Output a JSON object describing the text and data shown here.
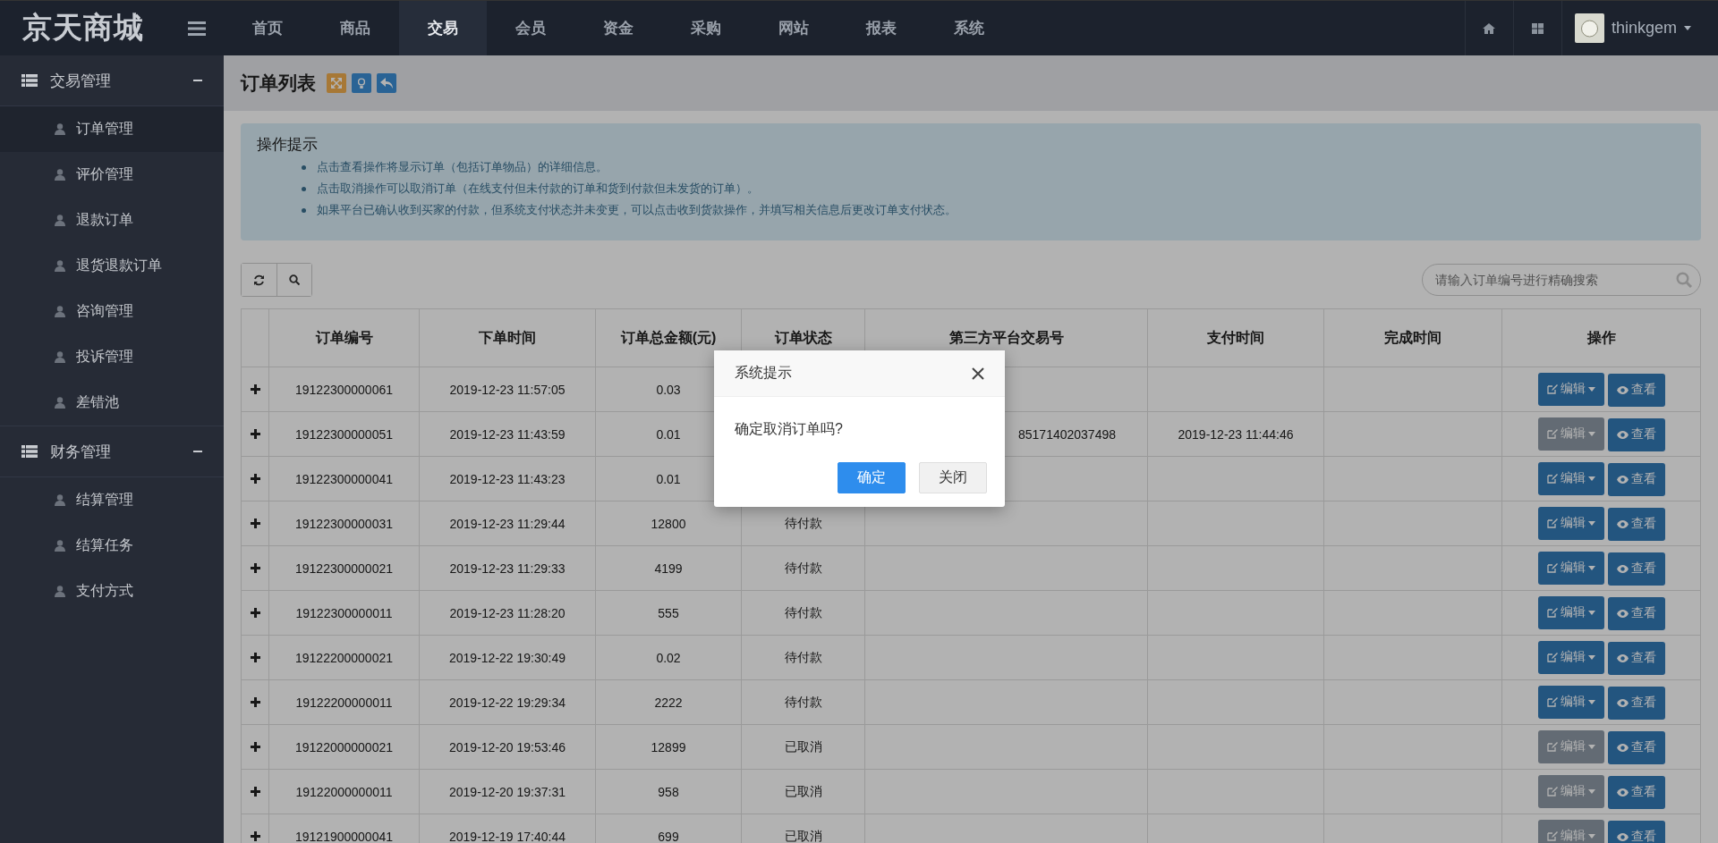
{
  "brand": "京天商城",
  "nav": [
    {
      "label": "首页",
      "selected": false
    },
    {
      "label": "商品",
      "selected": false
    },
    {
      "label": "交易",
      "selected": true
    },
    {
      "label": "会员",
      "selected": false
    },
    {
      "label": "资金",
      "selected": false
    },
    {
      "label": "采购",
      "selected": false
    },
    {
      "label": "网站",
      "selected": false
    },
    {
      "label": "报表",
      "selected": false
    },
    {
      "label": "系统",
      "selected": false
    }
  ],
  "user": {
    "name": "thinkgem"
  },
  "sidebar": [
    {
      "label": "交易管理",
      "expanded": true,
      "children": [
        {
          "label": "订单管理",
          "selected": true
        },
        {
          "label": "评价管理",
          "selected": false
        },
        {
          "label": "退款订单",
          "selected": false
        },
        {
          "label": "退货退款订单",
          "selected": false
        },
        {
          "label": "咨询管理",
          "selected": false
        },
        {
          "label": "投诉管理",
          "selected": false
        },
        {
          "label": "差错池",
          "selected": false
        }
      ]
    },
    {
      "label": "财务管理",
      "expanded": true,
      "children": [
        {
          "label": "结算管理",
          "selected": false
        },
        {
          "label": "结算任务",
          "selected": false
        },
        {
          "label": "支付方式",
          "selected": false
        }
      ]
    }
  ],
  "page": {
    "title": "订单列表"
  },
  "notice": {
    "title": "操作提示",
    "items": [
      "点击查看操作将显示订单（包括订单物品）的详细信息。",
      "点击取消操作可以取消订单（在线支付但未付款的订单和货到付款但未发货的订单）。",
      "如果平台已确认收到买家的付款，但系统支付状态并未变更，可以点击收到货款操作，并填写相关信息后更改订单支付状态。"
    ]
  },
  "search": {
    "placeholder": "请输入订单编号进行精确搜索"
  },
  "table": {
    "columns": [
      "订单编号",
      "下单时间",
      "订单总金额(元)",
      "订单状态",
      "第三方平台交易号",
      "支付时间",
      "完成时间",
      "操作"
    ],
    "rows": [
      {
        "order_no": "19122300000061",
        "time": "2019-12-23 11:57:05",
        "amount": "0.03",
        "edit": {
          "label": "编辑",
          "disabled": false
        },
        "view": "查看"
      },
      {
        "order_no": "19122300000051",
        "time": "2019-12-23 11:43:59",
        "amount": "0.01",
        "third_party": "85171402037498",
        "paid_time": "2019-12-23 11:44:46",
        "edit": {
          "label": "编辑",
          "disabled": true
        },
        "view": "查看"
      },
      {
        "order_no": "19122300000041",
        "time": "2019-12-23 11:43:23",
        "amount": "0.01",
        "edit": {
          "label": "编辑",
          "disabled": false
        },
        "view": "查看"
      },
      {
        "order_no": "19122300000031",
        "time": "2019-12-23 11:29:44",
        "amount": "12800",
        "status": "待付款",
        "edit": {
          "label": "编辑",
          "disabled": false
        },
        "view": "查看"
      },
      {
        "order_no": "19122300000021",
        "time": "2019-12-23 11:29:33",
        "amount": "4199",
        "status": "待付款",
        "edit": {
          "label": "编辑",
          "disabled": false
        },
        "view": "查看"
      },
      {
        "order_no": "19122300000011",
        "time": "2019-12-23 11:28:20",
        "amount": "555",
        "status": "待付款",
        "edit": {
          "label": "编辑",
          "disabled": false
        },
        "view": "查看"
      },
      {
        "order_no": "19122200000021",
        "time": "2019-12-22 19:30:49",
        "amount": "0.02",
        "status": "待付款",
        "edit": {
          "label": "编辑",
          "disabled": false
        },
        "view": "查看"
      },
      {
        "order_no": "19122200000011",
        "time": "2019-12-22 19:29:34",
        "amount": "2222",
        "status": "待付款",
        "edit": {
          "label": "编辑",
          "disabled": false
        },
        "view": "查看"
      },
      {
        "order_no": "19122000000021",
        "time": "2019-12-20 19:53:46",
        "amount": "12899",
        "status": "已取消",
        "edit": {
          "label": "编辑",
          "disabled": true
        },
        "view": "查看"
      },
      {
        "order_no": "19122000000011",
        "time": "2019-12-20 19:37:31",
        "amount": "958",
        "status": "已取消",
        "edit": {
          "label": "编辑",
          "disabled": true
        },
        "view": "查看"
      },
      {
        "order_no": "19121900000041",
        "time": "2019-12-19 17:40:44",
        "amount": "699",
        "status": "已取消",
        "edit": {
          "label": "编辑",
          "disabled": true
        },
        "view": "查看"
      }
    ]
  },
  "dialog": {
    "title": "系统提示",
    "message": "确定取消订单吗?",
    "buttons": [
      {
        "label": "确定",
        "kind": "primary"
      },
      {
        "label": "关闭",
        "kind": "default"
      }
    ]
  }
}
